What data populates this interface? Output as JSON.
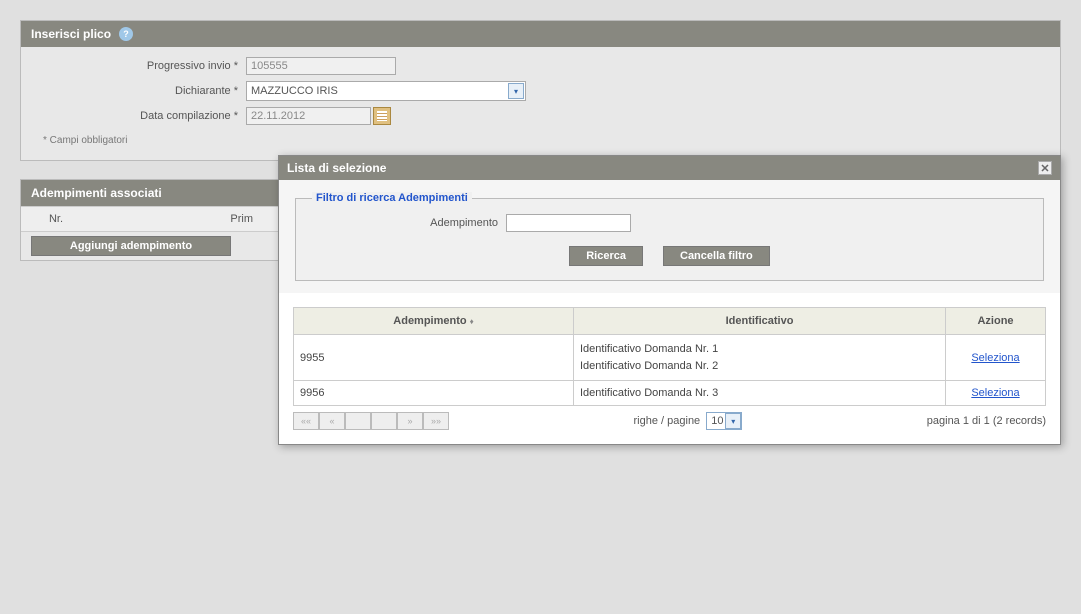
{
  "header": {
    "title": "Inserisci plico"
  },
  "form": {
    "progressivo_label": "Progressivo invio *",
    "progressivo_value": "105555",
    "dichiarante_label": "Dichiarante *",
    "dichiarante_value": "MAZZUCCO IRIS",
    "data_label": "Data compilazione *",
    "data_value": "22.11.2012",
    "mandatory_note": "* Campi obbligatori"
  },
  "assoc": {
    "title": "Adempimenti associati",
    "col_nr": "Nr.",
    "col_prim": "Prim",
    "add_btn": "Aggiungi adempimento"
  },
  "modal": {
    "title": "Lista di selezione",
    "filter_legend": "Filtro di ricerca Adempimenti",
    "filter_label": "Adempimento",
    "search_btn": "Ricerca",
    "clear_btn": "Cancella filtro",
    "col_adempimento": "Adempimento",
    "col_identificativo": "Identificativo",
    "col_azione": "Azione",
    "rows": [
      {
        "id": "9955",
        "ident1": "Identificativo Domanda Nr. 1",
        "ident2": "Identificativo Domanda Nr. 2",
        "action": "Seleziona "
      },
      {
        "id": "9956",
        "ident1": "Identificativo Domanda Nr. 3",
        "ident2": "",
        "action": "Seleziona "
      }
    ],
    "pager_rows_label": "righe / pagine",
    "page_size": "10",
    "pager_info": "pagina 1 di 1 (2 records)"
  }
}
